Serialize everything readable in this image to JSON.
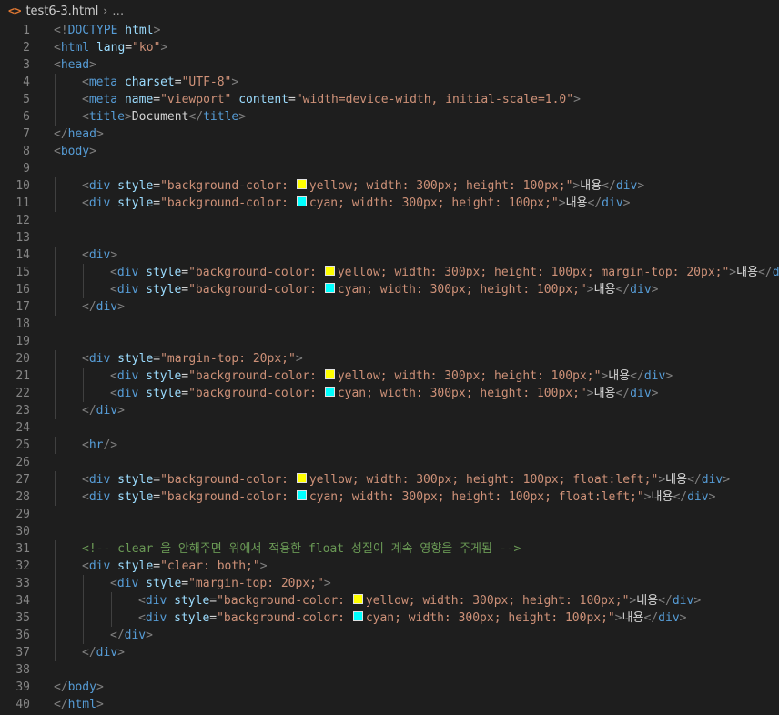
{
  "breadcrumb": {
    "file": "test6-3.html",
    "symbol": "…",
    "icon": "html-file-icon"
  },
  "colors": {
    "yellow": "#ffff00",
    "cyan": "#00ffff"
  },
  "lines": [
    {
      "n": "1",
      "indent": 0,
      "tokens": [
        [
          "tg",
          "<!"
        ],
        [
          "tn",
          "DOCTYPE"
        ],
        [
          "tx",
          " "
        ],
        [
          "at",
          "html"
        ],
        [
          "tg",
          ">"
        ]
      ]
    },
    {
      "n": "2",
      "indent": 0,
      "tokens": [
        [
          "tg",
          "<"
        ],
        [
          "tn",
          "html"
        ],
        [
          "tx",
          " "
        ],
        [
          "at",
          "lang"
        ],
        [
          "tx",
          "="
        ],
        [
          "st",
          "\"ko\""
        ],
        [
          "tg",
          ">"
        ]
      ]
    },
    {
      "n": "3",
      "indent": 0,
      "tokens": [
        [
          "tg",
          "<"
        ],
        [
          "tn",
          "head"
        ],
        [
          "tg",
          ">"
        ]
      ]
    },
    {
      "n": "4",
      "indent": 1,
      "tokens": [
        [
          "tg",
          "<"
        ],
        [
          "tn",
          "meta"
        ],
        [
          "tx",
          " "
        ],
        [
          "at",
          "charset"
        ],
        [
          "tx",
          "="
        ],
        [
          "st",
          "\"UTF-8\""
        ],
        [
          "tg",
          ">"
        ]
      ]
    },
    {
      "n": "5",
      "indent": 1,
      "tokens": [
        [
          "tg",
          "<"
        ],
        [
          "tn",
          "meta"
        ],
        [
          "tx",
          " "
        ],
        [
          "at",
          "name"
        ],
        [
          "tx",
          "="
        ],
        [
          "st",
          "\"viewport\""
        ],
        [
          "tx",
          " "
        ],
        [
          "at",
          "content"
        ],
        [
          "tx",
          "="
        ],
        [
          "st",
          "\"width=device-width, initial-scale=1.0\""
        ],
        [
          "tg",
          ">"
        ]
      ]
    },
    {
      "n": "6",
      "indent": 1,
      "tokens": [
        [
          "tg",
          "<"
        ],
        [
          "tn",
          "title"
        ],
        [
          "tg",
          ">"
        ],
        [
          "tx",
          "Document"
        ],
        [
          "tg",
          "</"
        ],
        [
          "tn",
          "title"
        ],
        [
          "tg",
          ">"
        ]
      ]
    },
    {
      "n": "7",
      "indent": 0,
      "tokens": [
        [
          "tg",
          "</"
        ],
        [
          "tn",
          "head"
        ],
        [
          "tg",
          ">"
        ]
      ]
    },
    {
      "n": "8",
      "indent": 0,
      "tokens": [
        [
          "tg",
          "<"
        ],
        [
          "tn",
          "body"
        ],
        [
          "tg",
          ">"
        ]
      ]
    },
    {
      "n": "9",
      "indent": 0,
      "tokens": []
    },
    {
      "n": "10",
      "indent": 1,
      "tokens": [
        [
          "tg",
          "<"
        ],
        [
          "tn",
          "div"
        ],
        [
          "tx",
          " "
        ],
        [
          "at",
          "style"
        ],
        [
          "tx",
          "="
        ],
        [
          "st",
          "\"background-color: "
        ],
        [
          "sw",
          "yellow"
        ],
        [
          "st",
          "yellow; width: 300px; height: 100px;\""
        ],
        [
          "tg",
          ">"
        ],
        [
          "tx",
          "내용"
        ],
        [
          "tg",
          "</"
        ],
        [
          "tn",
          "div"
        ],
        [
          "tg",
          ">"
        ]
      ]
    },
    {
      "n": "11",
      "indent": 1,
      "tokens": [
        [
          "tg",
          "<"
        ],
        [
          "tn",
          "div"
        ],
        [
          "tx",
          " "
        ],
        [
          "at",
          "style"
        ],
        [
          "tx",
          "="
        ],
        [
          "st",
          "\"background-color: "
        ],
        [
          "sw",
          "cyan"
        ],
        [
          "st",
          "cyan; width: 300px; height: 100px;\""
        ],
        [
          "tg",
          ">"
        ],
        [
          "tx",
          "내용"
        ],
        [
          "tg",
          "</"
        ],
        [
          "tn",
          "div"
        ],
        [
          "tg",
          ">"
        ]
      ]
    },
    {
      "n": "12",
      "indent": 0,
      "tokens": []
    },
    {
      "n": "13",
      "indent": 0,
      "tokens": []
    },
    {
      "n": "14",
      "indent": 1,
      "tokens": [
        [
          "tg",
          "<"
        ],
        [
          "tn",
          "div"
        ],
        [
          "tg",
          ">"
        ]
      ]
    },
    {
      "n": "15",
      "indent": 2,
      "tokens": [
        [
          "tg",
          "<"
        ],
        [
          "tn",
          "div"
        ],
        [
          "tx",
          " "
        ],
        [
          "at",
          "style"
        ],
        [
          "tx",
          "="
        ],
        [
          "st",
          "\"background-color: "
        ],
        [
          "sw",
          "yellow"
        ],
        [
          "st",
          "yellow; width: 300px; height: 100px; margin-top: 20px;\""
        ],
        [
          "tg",
          ">"
        ],
        [
          "tx",
          "내용"
        ],
        [
          "tg",
          "</"
        ],
        [
          "tn",
          "div"
        ],
        [
          "tg",
          ">"
        ]
      ]
    },
    {
      "n": "16",
      "indent": 2,
      "tokens": [
        [
          "tg",
          "<"
        ],
        [
          "tn",
          "div"
        ],
        [
          "tx",
          " "
        ],
        [
          "at",
          "style"
        ],
        [
          "tx",
          "="
        ],
        [
          "st",
          "\"background-color: "
        ],
        [
          "sw",
          "cyan"
        ],
        [
          "st",
          "cyan; width: 300px; height: 100px;\""
        ],
        [
          "tg",
          ">"
        ],
        [
          "tx",
          "내용"
        ],
        [
          "tg",
          "</"
        ],
        [
          "tn",
          "div"
        ],
        [
          "tg",
          ">"
        ]
      ]
    },
    {
      "n": "17",
      "indent": 1,
      "tokens": [
        [
          "tg",
          "</"
        ],
        [
          "tn",
          "div"
        ],
        [
          "tg",
          ">"
        ]
      ]
    },
    {
      "n": "18",
      "indent": 0,
      "tokens": []
    },
    {
      "n": "19",
      "indent": 0,
      "tokens": []
    },
    {
      "n": "20",
      "indent": 1,
      "tokens": [
        [
          "tg",
          "<"
        ],
        [
          "tn",
          "div"
        ],
        [
          "tx",
          " "
        ],
        [
          "at",
          "style"
        ],
        [
          "tx",
          "="
        ],
        [
          "st",
          "\"margin-top: 20px;\""
        ],
        [
          "tg",
          ">"
        ]
      ]
    },
    {
      "n": "21",
      "indent": 2,
      "tokens": [
        [
          "tg",
          "<"
        ],
        [
          "tn",
          "div"
        ],
        [
          "tx",
          " "
        ],
        [
          "at",
          "style"
        ],
        [
          "tx",
          "="
        ],
        [
          "st",
          "\"background-color: "
        ],
        [
          "sw",
          "yellow"
        ],
        [
          "st",
          "yellow; width: 300px; height: 100px;\""
        ],
        [
          "tg",
          ">"
        ],
        [
          "tx",
          "내용"
        ],
        [
          "tg",
          "</"
        ],
        [
          "tn",
          "div"
        ],
        [
          "tg",
          ">"
        ]
      ]
    },
    {
      "n": "22",
      "indent": 2,
      "tokens": [
        [
          "tg",
          "<"
        ],
        [
          "tn",
          "div"
        ],
        [
          "tx",
          " "
        ],
        [
          "at",
          "style"
        ],
        [
          "tx",
          "="
        ],
        [
          "st",
          "\"background-color: "
        ],
        [
          "sw",
          "cyan"
        ],
        [
          "st",
          "cyan; width: 300px; height: 100px;\""
        ],
        [
          "tg",
          ">"
        ],
        [
          "tx",
          "내용"
        ],
        [
          "tg",
          "</"
        ],
        [
          "tn",
          "div"
        ],
        [
          "tg",
          ">"
        ]
      ]
    },
    {
      "n": "23",
      "indent": 1,
      "tokens": [
        [
          "tg",
          "</"
        ],
        [
          "tn",
          "div"
        ],
        [
          "tg",
          ">"
        ]
      ]
    },
    {
      "n": "24",
      "indent": 0,
      "tokens": []
    },
    {
      "n": "25",
      "indent": 1,
      "tokens": [
        [
          "tg",
          "<"
        ],
        [
          "tn",
          "hr"
        ],
        [
          "tg",
          "/>"
        ]
      ]
    },
    {
      "n": "26",
      "indent": 0,
      "tokens": []
    },
    {
      "n": "27",
      "indent": 1,
      "tokens": [
        [
          "tg",
          "<"
        ],
        [
          "tn",
          "div"
        ],
        [
          "tx",
          " "
        ],
        [
          "at",
          "style"
        ],
        [
          "tx",
          "="
        ],
        [
          "st",
          "\"background-color: "
        ],
        [
          "sw",
          "yellow"
        ],
        [
          "st",
          "yellow; width: 300px; height: 100px; float:left;\""
        ],
        [
          "tg",
          ">"
        ],
        [
          "tx",
          "내용"
        ],
        [
          "tg",
          "</"
        ],
        [
          "tn",
          "div"
        ],
        [
          "tg",
          ">"
        ]
      ]
    },
    {
      "n": "28",
      "indent": 1,
      "tokens": [
        [
          "tg",
          "<"
        ],
        [
          "tn",
          "div"
        ],
        [
          "tx",
          " "
        ],
        [
          "at",
          "style"
        ],
        [
          "tx",
          "="
        ],
        [
          "st",
          "\"background-color: "
        ],
        [
          "sw",
          "cyan"
        ],
        [
          "st",
          "cyan; width: 300px; height: 100px; float:left;\""
        ],
        [
          "tg",
          ">"
        ],
        [
          "tx",
          "내용"
        ],
        [
          "tg",
          "</"
        ],
        [
          "tn",
          "div"
        ],
        [
          "tg",
          ">"
        ]
      ]
    },
    {
      "n": "29",
      "indent": 0,
      "tokens": []
    },
    {
      "n": "30",
      "indent": 0,
      "tokens": []
    },
    {
      "n": "31",
      "indent": 1,
      "tokens": [
        [
          "cm",
          "<!-- clear 을 안해주면 위에서 적용한 float 성질이 계속 영향을 주게됨 -->"
        ]
      ]
    },
    {
      "n": "32",
      "indent": 1,
      "tokens": [
        [
          "tg",
          "<"
        ],
        [
          "tn",
          "div"
        ],
        [
          "tx",
          " "
        ],
        [
          "at",
          "style"
        ],
        [
          "tx",
          "="
        ],
        [
          "st",
          "\"clear: both;\""
        ],
        [
          "tg",
          ">"
        ]
      ]
    },
    {
      "n": "33",
      "indent": 2,
      "tokens": [
        [
          "tg",
          "<"
        ],
        [
          "tn",
          "div"
        ],
        [
          "tx",
          " "
        ],
        [
          "at",
          "style"
        ],
        [
          "tx",
          "="
        ],
        [
          "st",
          "\"margin-top: 20px;\""
        ],
        [
          "tg",
          ">"
        ]
      ]
    },
    {
      "n": "34",
      "indent": 3,
      "tokens": [
        [
          "tg",
          "<"
        ],
        [
          "tn",
          "div"
        ],
        [
          "tx",
          " "
        ],
        [
          "at",
          "style"
        ],
        [
          "tx",
          "="
        ],
        [
          "st",
          "\"background-color: "
        ],
        [
          "sw",
          "yellow"
        ],
        [
          "st",
          "yellow; width: 300px; height: 100px;\""
        ],
        [
          "tg",
          ">"
        ],
        [
          "tx",
          "내용"
        ],
        [
          "tg",
          "</"
        ],
        [
          "tn",
          "div"
        ],
        [
          "tg",
          ">"
        ]
      ]
    },
    {
      "n": "35",
      "indent": 3,
      "tokens": [
        [
          "tg",
          "<"
        ],
        [
          "tn",
          "div"
        ],
        [
          "tx",
          " "
        ],
        [
          "at",
          "style"
        ],
        [
          "tx",
          "="
        ],
        [
          "st",
          "\"background-color: "
        ],
        [
          "sw",
          "cyan"
        ],
        [
          "st",
          "cyan; width: 300px; height: 100px;\""
        ],
        [
          "tg",
          ">"
        ],
        [
          "tx",
          "내용"
        ],
        [
          "tg",
          "</"
        ],
        [
          "tn",
          "div"
        ],
        [
          "tg",
          ">"
        ]
      ]
    },
    {
      "n": "36",
      "indent": 2,
      "tokens": [
        [
          "tg",
          "</"
        ],
        [
          "tn",
          "div"
        ],
        [
          "tg",
          ">"
        ]
      ]
    },
    {
      "n": "37",
      "indent": 1,
      "tokens": [
        [
          "tg",
          "</"
        ],
        [
          "tn",
          "div"
        ],
        [
          "tg",
          ">"
        ]
      ]
    },
    {
      "n": "38",
      "indent": 0,
      "tokens": []
    },
    {
      "n": "39",
      "indent": 0,
      "tokens": [
        [
          "tg",
          "</"
        ],
        [
          "tn",
          "body"
        ],
        [
          "tg",
          ">"
        ]
      ]
    },
    {
      "n": "40",
      "indent": 0,
      "tokens": [
        [
          "tg",
          "</"
        ],
        [
          "tn",
          "html"
        ],
        [
          "tg",
          ">"
        ]
      ]
    }
  ]
}
